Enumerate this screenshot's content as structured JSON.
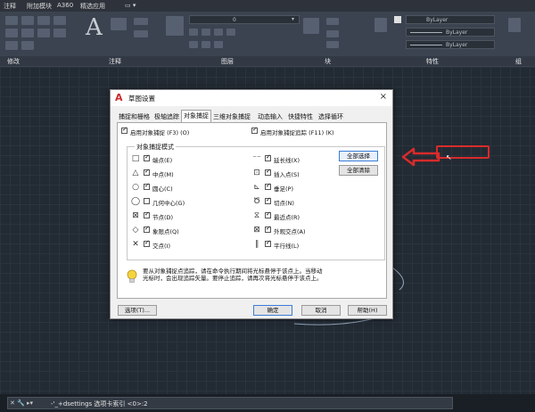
{
  "ribbon": {
    "tabs": [
      "注释",
      "附加模块",
      "A360",
      "精选应用"
    ],
    "panels": [
      "修改",
      "注释",
      "图层",
      "块",
      "特性",
      "组"
    ],
    "bylayer_1": "ByLayer",
    "bylayer_2": "ByLayer",
    "bylayer_3": "ByLayer",
    "big_letter": "A",
    "layer_value": "0"
  },
  "dialog": {
    "title": "草图设置",
    "close_glyph": "×",
    "tabs": [
      "捕捉和栅格",
      "极轴追踪",
      "对象捕捉",
      "三维对象捕捉",
      "动态输入",
      "快捷特性",
      "选择循环"
    ],
    "active_tab_index": 2,
    "enable_osnap": "启用对象捕捉 (F3) (O)",
    "enable_tracking": "启用对象捕捉追踪 (F11) (K)",
    "group_title": "对象捕捉模式",
    "snap_modes_left": [
      {
        "symbol": "□",
        "label": "端点(E)"
      },
      {
        "symbol": "△",
        "label": "中点(M)"
      },
      {
        "symbol": "○",
        "label": "圆心(C)"
      },
      {
        "symbol": "◯",
        "label": "几何中心(G)"
      },
      {
        "symbol": "⊠",
        "label": "节点(D)"
      },
      {
        "symbol": "◇",
        "label": "象限点(Q)"
      },
      {
        "symbol": "✕",
        "label": "交点(I)"
      }
    ],
    "snap_modes_right": [
      {
        "symbol": "⁻⁻",
        "label": "延长线(X)"
      },
      {
        "symbol": "⊡",
        "label": "插入点(S)"
      },
      {
        "symbol": "⊾",
        "label": "垂足(P)"
      },
      {
        "symbol": "Ծ",
        "label": "切点(N)"
      },
      {
        "symbol": "⧖",
        "label": "最近点(R)"
      },
      {
        "symbol": "⊠",
        "label": "外观交点(A)"
      },
      {
        "symbol": "∥",
        "label": "平行线(L)"
      }
    ],
    "select_all": "全部选择",
    "clear_all": "全部清除",
    "info_line1": "要从对象捕捉点追踪，请在命令执行期间将光标悬停于该点上。当移动",
    "info_line2": "光标时，会出现追踪矢量。要停止追踪，请再次将光标悬停于该点上。",
    "options_button": "选项(T)...",
    "ok_button": "确定",
    "cancel_button": "取消",
    "help_button": "帮助(H)"
  },
  "command_line": {
    "icons": "✕ 🔧 ▸▾",
    "text": "-'_+dsettings 选项卡索引 <0>:2"
  },
  "colors": {
    "accent_red": "#d92b2b",
    "focus_blue": "#3b7ed8"
  }
}
